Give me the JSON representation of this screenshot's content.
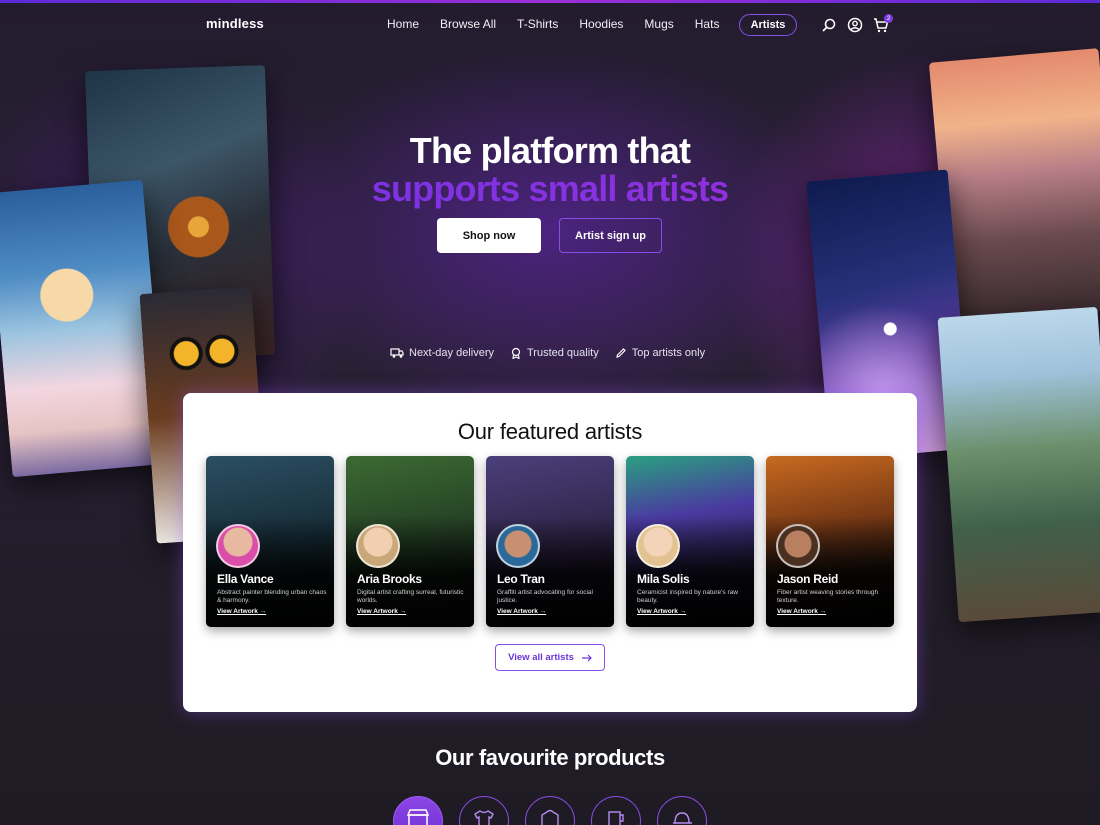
{
  "brand": {
    "name": "mindless",
    "accent": "#7b3be0",
    "accent_secondary": "#a32ed8"
  },
  "nav": {
    "links": [
      "Home",
      "Browse All",
      "T-Shirts",
      "Hoodies",
      "Mugs",
      "Hats"
    ],
    "artists_label": "Artists",
    "icons": [
      "search-icon",
      "account-icon",
      "cart-icon"
    ],
    "cart_count": "2"
  },
  "hero": {
    "title_line1": "The platform that",
    "title_line2": "supports small artists",
    "primary_button": "Shop now",
    "secondary_button": "Artist sign up",
    "features": [
      {
        "icon": "truck-icon",
        "label": "Next-day delivery"
      },
      {
        "icon": "badge-icon",
        "label": "Trusted quality"
      },
      {
        "icon": "pencil-icon",
        "label": "Top artists only"
      }
    ]
  },
  "featured": {
    "title": "Our featured artists",
    "artists": [
      {
        "name": "Ella Vance",
        "desc": "Abstract painter blending urban chaos & harmony.",
        "link": "View Artwork",
        "bg": "#1d3a4a"
      },
      {
        "name": "Aria Brooks",
        "desc": "Digital artist crafting surreal, futuristic worlds.",
        "link": "View Artwork",
        "bg": "#2f4a2a"
      },
      {
        "name": "Leo Tran",
        "desc": "Graffiti artist advocating for social justice.",
        "link": "View Artwork",
        "bg": "#3b2f5a"
      },
      {
        "name": "Mila Solis",
        "desc": "Ceramicist inspired by nature's raw beauty.",
        "link": "View Artwork",
        "bg": "#2a2f6a"
      },
      {
        "name": "Jason Reid",
        "desc": "Fiber artist weaving stories through texture.",
        "link": "View Artwork",
        "bg": "#6a3a1a"
      }
    ],
    "view_all": "View all artists"
  },
  "favourites": {
    "title": "Our favourite products",
    "categories": [
      "storefront-icon",
      "tshirt-icon",
      "hoodie-icon",
      "mug-icon",
      "hat-icon"
    ]
  }
}
